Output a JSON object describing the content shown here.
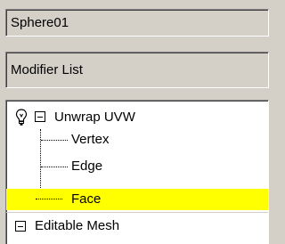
{
  "object_name": "Sphere01",
  "modifier_list_label": "Modifier List",
  "stack": {
    "modifier": {
      "label": "Unwrap UVW",
      "icon": "light-bulb-icon",
      "expanded": true,
      "sub_objects": [
        {
          "label": "Vertex",
          "selected": false
        },
        {
          "label": "Edge",
          "selected": false
        },
        {
          "label": "Face",
          "selected": true
        }
      ]
    },
    "base_object": {
      "label": "Editable Mesh",
      "expanded": false
    }
  },
  "colors": {
    "panel_bg": "#d4d0c8",
    "stack_bg": "#ffffff",
    "selection_highlight": "#ffff00"
  }
}
